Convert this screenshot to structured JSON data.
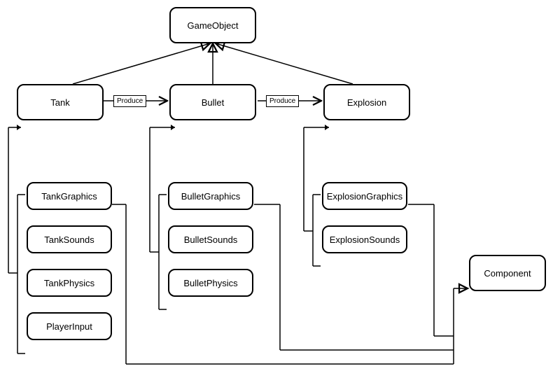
{
  "nodes": {
    "gameObject": "GameObject",
    "tank": "Tank",
    "bullet": "Bullet",
    "explosion": "Explosion",
    "tankGraphics": "TankGraphics",
    "tankSounds": "TankSounds",
    "tankPhysics": "TankPhysics",
    "playerInput": "PlayerInput",
    "bulletGraphics": "BulletGraphics",
    "bulletSounds": "BulletSounds",
    "bulletPhysics": "BulletPhysics",
    "explosionGraphics": "ExplosionGraphics",
    "explosionSounds": "ExplosionSounds",
    "component": "Component"
  },
  "edgeLabels": {
    "tankToBullet": "Produce",
    "bulletToExplosion": "Produce"
  }
}
